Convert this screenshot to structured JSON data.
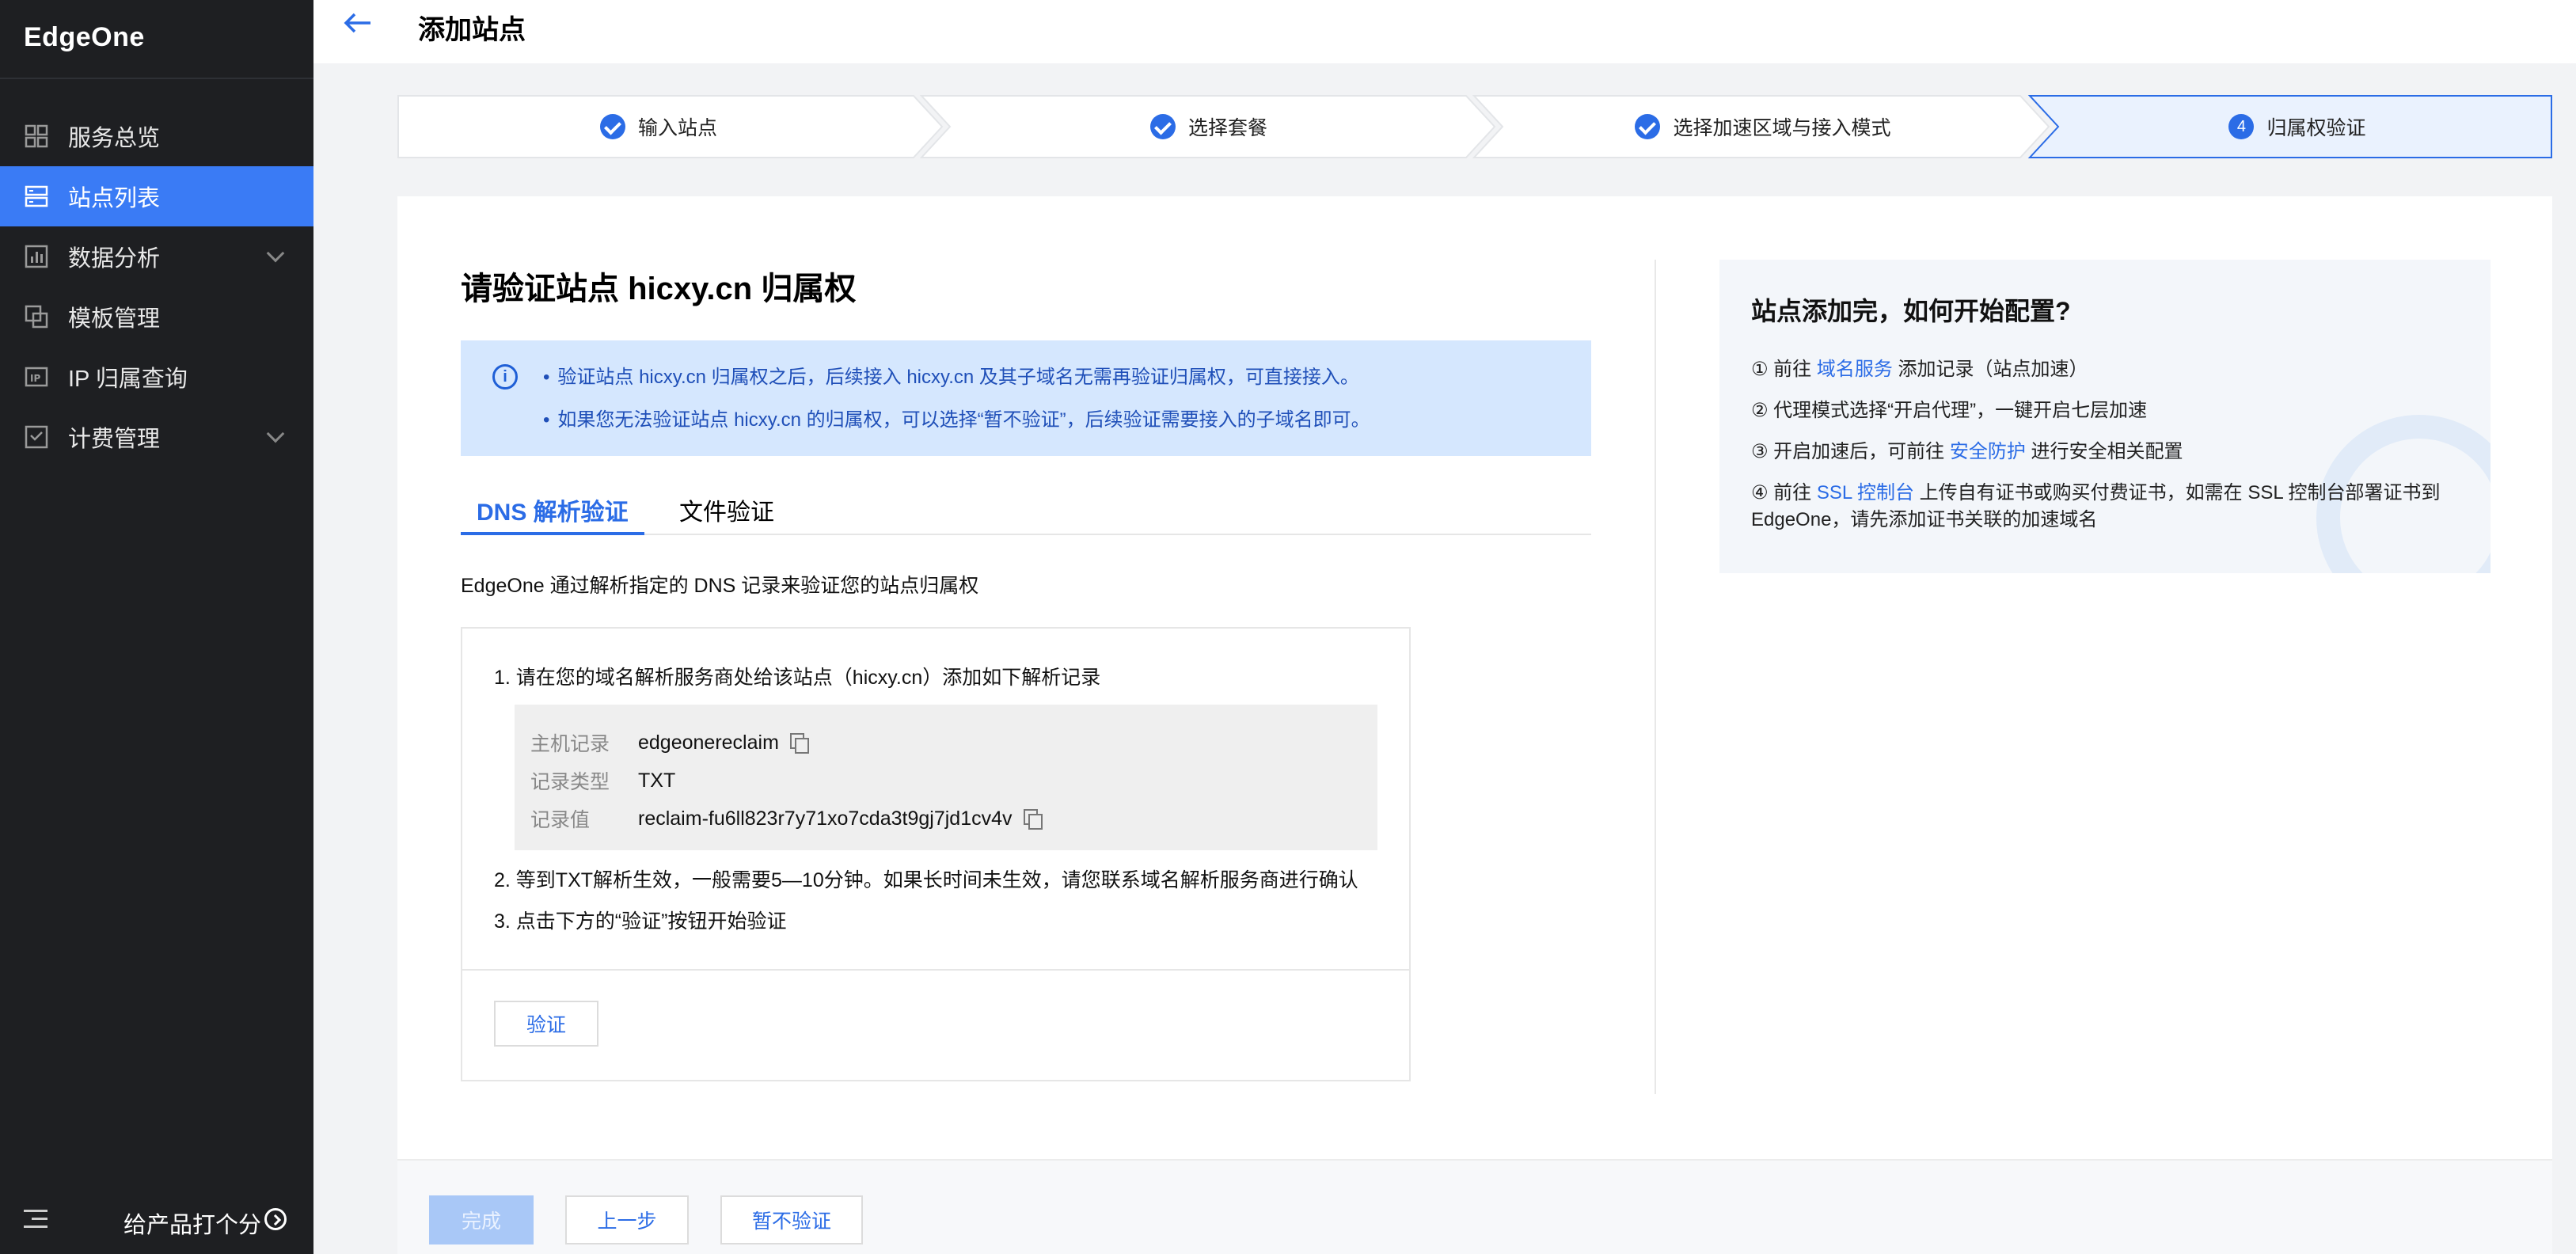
{
  "sidebar": {
    "brand": "EdgeOne",
    "items": [
      {
        "label": "服务总览",
        "icon": "grid-icon",
        "active": false,
        "expandable": false
      },
      {
        "label": "站点列表",
        "icon": "list-icon",
        "active": true,
        "expandable": false
      },
      {
        "label": "数据分析",
        "icon": "chart-icon",
        "active": false,
        "expandable": true
      },
      {
        "label": "模板管理",
        "icon": "template-icon",
        "active": false,
        "expandable": false
      },
      {
        "label": "IP 归属查询",
        "icon": "ip-icon",
        "active": false,
        "expandable": false
      },
      {
        "label": "计费管理",
        "icon": "billing-icon",
        "active": false,
        "expandable": true
      }
    ],
    "footer_label": "给产品打个分"
  },
  "header": {
    "title": "添加站点"
  },
  "steps": [
    {
      "label": "输入站点",
      "done": true
    },
    {
      "label": "选择套餐",
      "done": true
    },
    {
      "label": "选择加速区域与接入模式",
      "done": true
    },
    {
      "label": "归属权验证",
      "number": "4",
      "current": true
    }
  ],
  "main": {
    "heading": "请验证站点 hicxy.cn 归属权",
    "info": [
      "验证站点 hicxy.cn 归属权之后，后续接入 hicxy.cn 及其子域名无需再验证归属权，可直接接入。",
      "如果您无法验证站点 hicxy.cn 的归属权，可以选择“暂不验证”，后续验证需要接入的子域名即可。"
    ],
    "tabs": [
      {
        "label": "DNS 解析验证",
        "active": true
      },
      {
        "label": "文件验证",
        "active": false
      }
    ],
    "description": "EdgeOne 通过解析指定的 DNS 记录来验证您的站点归属权",
    "dns": {
      "step1": "1. 请在您的域名解析服务商处给该站点（hicxy.cn）添加如下解析记录",
      "records": [
        {
          "label": "主机记录",
          "value": "edgeonereclaim",
          "copyable": true
        },
        {
          "label": "记录类型",
          "value": "TXT",
          "copyable": false
        },
        {
          "label": "记录值",
          "value": "reclaim-fu6ll823r7y71xo7cda3t9gj7jd1cv4v",
          "copyable": true
        }
      ],
      "step2": "2. 等到TXT解析生效，一般需要5—10分钟。如果长时间未生效，请您联系域名解析服务商进行确认",
      "step3": "3. 点击下方的“验证”按钮开始验证",
      "verify_label": "验证"
    }
  },
  "help": {
    "title": "站点添加完，如何开始配置?",
    "line1": {
      "prefix": "① 前往 ",
      "link": "域名服务",
      "suffix": " 添加记录（站点加速）"
    },
    "line2": "② 代理模式选择“开启代理”，一键开启七层加速",
    "line3": {
      "prefix": "③ 开启加速后，可前往 ",
      "link": "安全防护",
      "suffix": " 进行安全相关配置"
    },
    "line4": {
      "prefix": "④ 前往 ",
      "link": "SSL 控制台",
      "suffix": " 上传自有证书或购买付费证书，如需在 SSL 控制台部署证书到 EdgeOne，请先添加证书关联的加速域名"
    }
  },
  "footer": {
    "finish_label": "完成",
    "prev_label": "上一步",
    "skip_label": "暂不验证"
  },
  "colors": {
    "accent": "#2b6ce6",
    "sidebar_bg": "#1e1f22",
    "sidebar_active": "#3a7bf5",
    "info_bg": "#d5e7fe"
  }
}
